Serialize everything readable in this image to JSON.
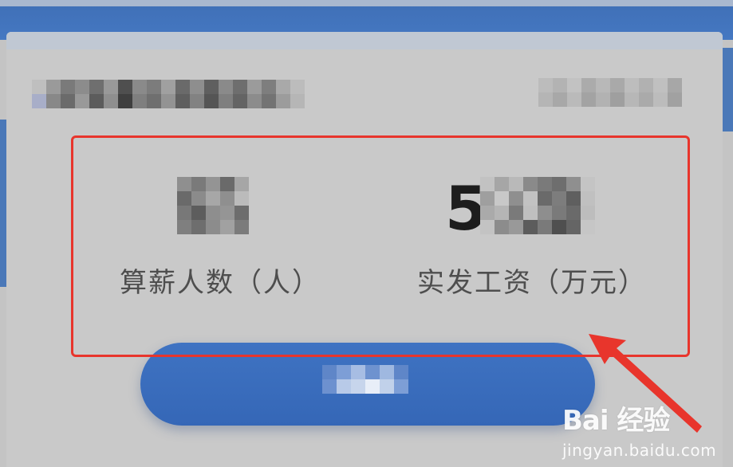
{
  "header": {
    "accent_color": "#4578c2"
  },
  "stats": [
    {
      "label": "算薪人数（人）",
      "value_visible_prefix": ""
    },
    {
      "label": "实发工资（万元）",
      "value_visible_prefix": "5"
    }
  ],
  "annotation": {
    "box_color": "#e8352c",
    "arrow_color": "#e8352c"
  },
  "button": {
    "color": "#3f73c2"
  },
  "watermark": {
    "logo": "Bai 经验",
    "url": "jingyan.baidu.com"
  }
}
